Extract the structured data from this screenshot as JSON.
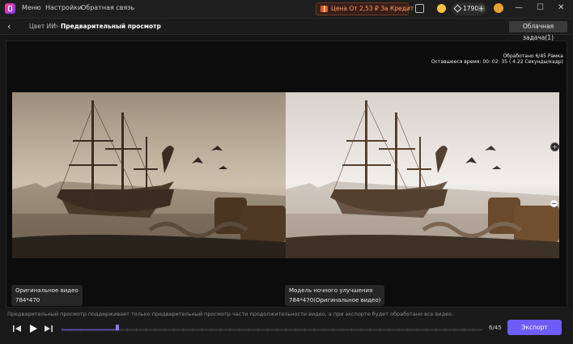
{
  "menu": {
    "items": [
      "Меню",
      "Настройки",
      "Обратная связь"
    ]
  },
  "promo": {
    "text": "Цена От 2,53 ₽ За Кредит"
  },
  "credits": {
    "value": "1790",
    "add": "+"
  },
  "window": {
    "minimize": "—",
    "maximize": "☐",
    "close": "✕"
  },
  "breadcrumb": {
    "back": "‹",
    "parent": "Цвет ИИ",
    "separator": ">",
    "current": "Предварительный просмотр"
  },
  "cloud_task": {
    "label": "Облачная задача(1)"
  },
  "progress": {
    "processed": "Обработано 6/45 Рамка",
    "remaining": "Оставшееся время: 00: 02: 35 ( 4.22 Секунды/кадр)"
  },
  "preview": {
    "original_label": "Оригинальное видео",
    "original_res": "784*470",
    "enhanced_label": "Модель ночного улучшения",
    "enhanced_res": "784*470(Оригинальное видео)",
    "zoom_in": "+",
    "zoom_out": "−"
  },
  "notice": "Предварительный просмотр поддерживает только предварительный просмотр части продолжительности видео, а при экспорте будет обработано все видео.",
  "player": {
    "frame_count": "6/45",
    "position_fraction": 0.11,
    "buffered_fraction": 0.133
  },
  "export": {
    "label": "Экспорт"
  },
  "colors": {
    "accent": "#6e5cf6",
    "promo": "#ff9a5e",
    "coin": "#f4c542"
  },
  "icons": [
    "app-logo-icon",
    "gift-icon",
    "message-icon",
    "coin-icon",
    "diamond-icon",
    "plus-icon",
    "avatar-icon",
    "minimize-icon",
    "maximize-icon",
    "close-icon",
    "back-icon",
    "zoom-in-icon",
    "zoom-out-icon",
    "prev-frame-icon",
    "play-icon",
    "next-frame-icon"
  ]
}
